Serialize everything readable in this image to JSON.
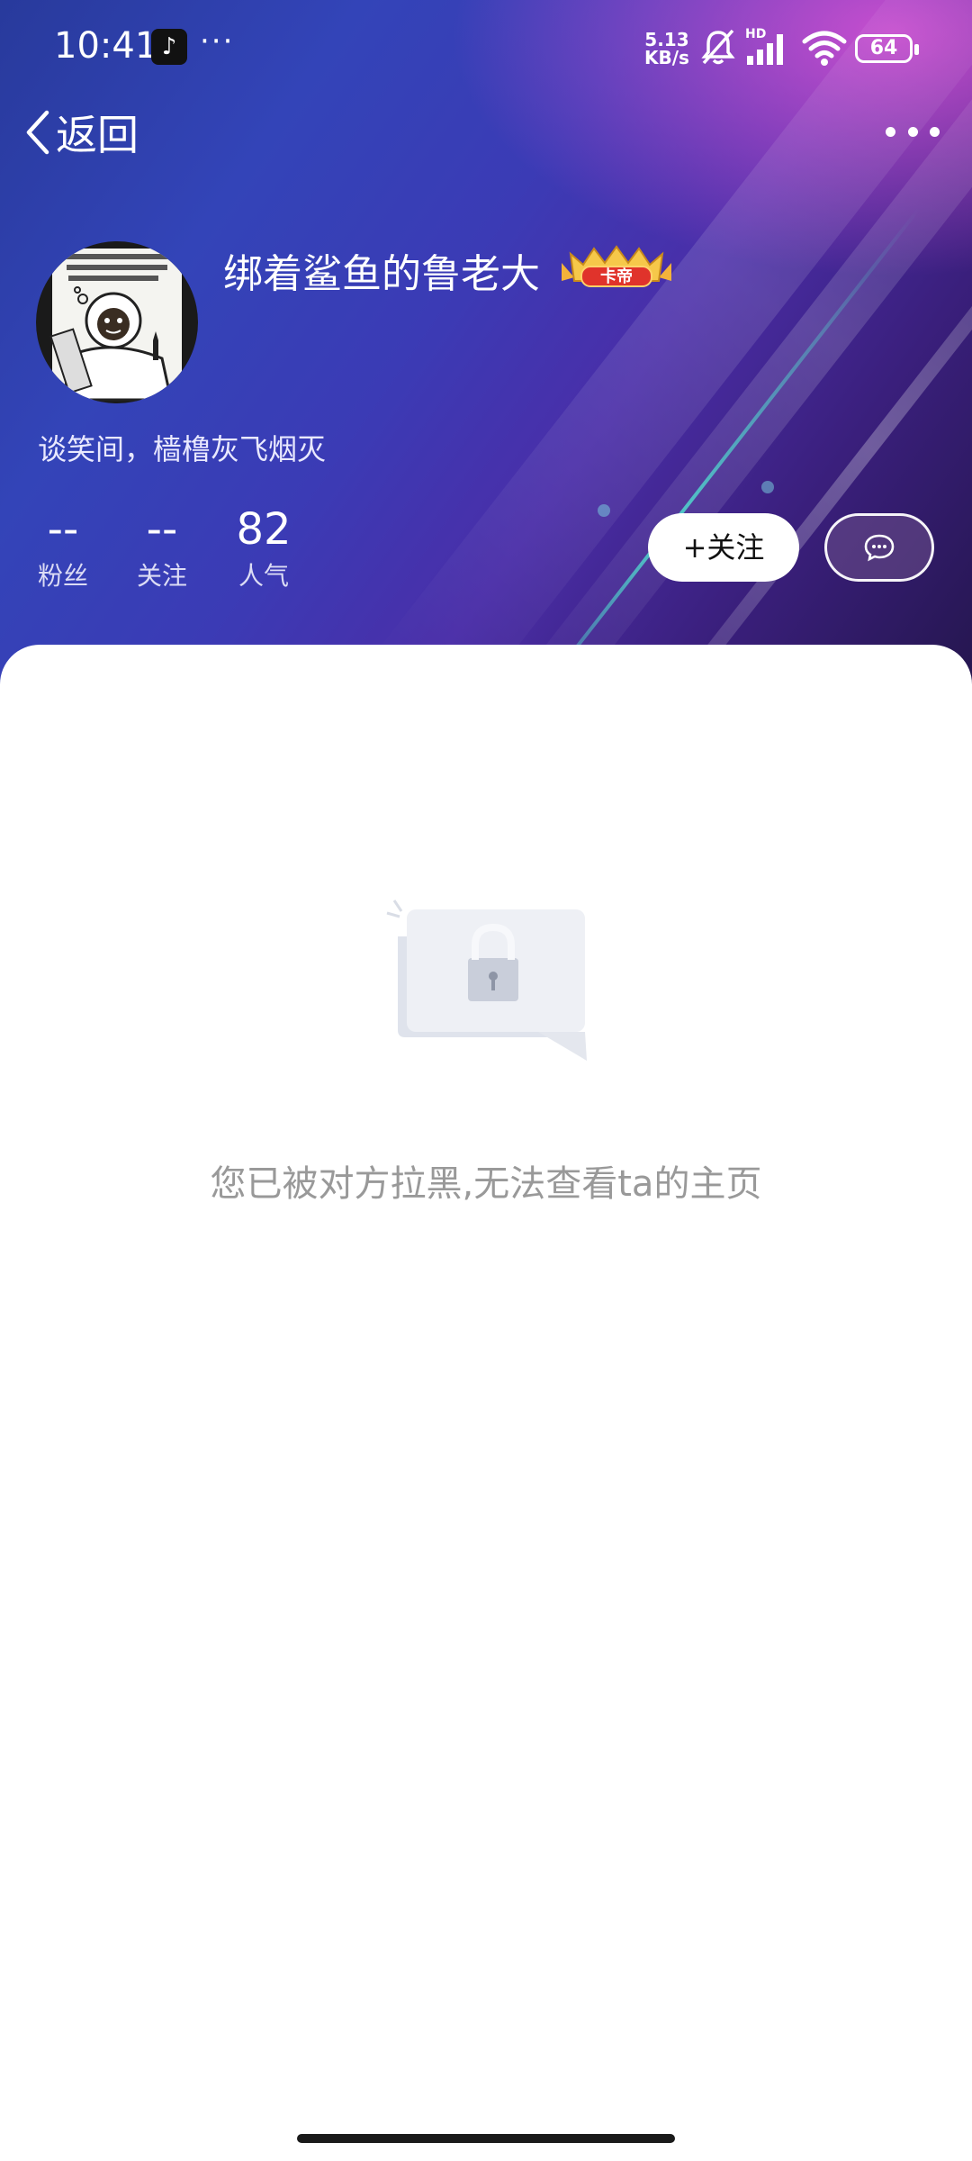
{
  "status_bar": {
    "time": "10:41",
    "more": "···",
    "net_speed_value": "5.13",
    "net_speed_unit": "KB/s",
    "signal_label": "HD",
    "battery": "64"
  },
  "nav": {
    "back_label": "返回"
  },
  "profile": {
    "username": "绑着鲨鱼的鲁老大",
    "badge_text": "卡帝",
    "bio": "谈笑间，樯橹灰飞烟灭",
    "stats": [
      {
        "value": "--",
        "label": "粉丝"
      },
      {
        "value": "--",
        "label": "关注"
      },
      {
        "value": "82",
        "label": "人气"
      }
    ],
    "follow_label": "+关注"
  },
  "content": {
    "blocked_message": "您已被对方拉黑,无法查看ta的主页"
  },
  "colors": {
    "header_start": "#283a9c",
    "header_end": "#25164f",
    "accent_pink": "#e85bd8",
    "muted_text": "#999999"
  }
}
